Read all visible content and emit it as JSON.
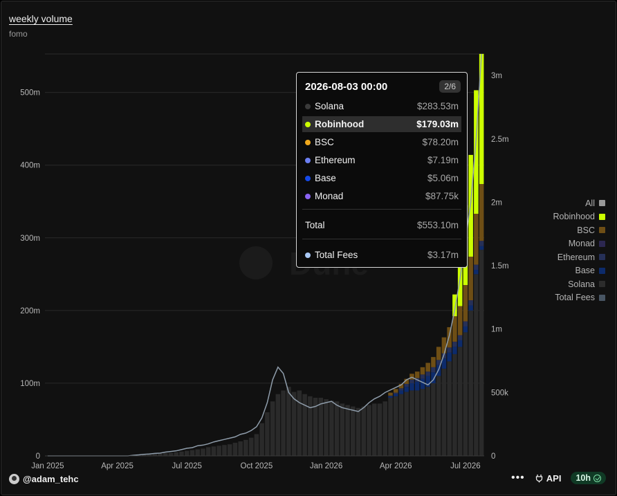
{
  "title": "weekly volume",
  "subtitle": "fomo",
  "footer": {
    "user": "@adam_tehc",
    "more": "•••",
    "api": "API",
    "refresh": "10h"
  },
  "tooltip": {
    "date": "2026-08-03 00:00",
    "page": "2/6",
    "rows": [
      {
        "name": "Solana",
        "value": "$283.53m",
        "color": "#3a3a3a"
      },
      {
        "name": "Robinhood",
        "value": "$179.03m",
        "color": "#ccff00",
        "highlight": true
      },
      {
        "name": "BSC",
        "value": "$78.20m",
        "color": "#f0a81c"
      },
      {
        "name": "Ethereum",
        "value": "$7.19m",
        "color": "#6c7ff2"
      },
      {
        "name": "Base",
        "value": "$5.06m",
        "color": "#1549e8"
      },
      {
        "name": "Monad",
        "value": "$87.75k",
        "color": "#8a63f2"
      }
    ],
    "total_label": "Total",
    "total_value": "$553.10m",
    "fees_label": "Total Fees",
    "fees_value": "$3.17m",
    "fees_color": "#a9c8f5"
  },
  "legend": [
    {
      "label": "All",
      "color": "#9a9a9a"
    },
    {
      "label": "Robinhood",
      "color": "#ccff00"
    },
    {
      "label": "BSC",
      "color": "#6e4e15"
    },
    {
      "label": "Monad",
      "color": "#2c2750"
    },
    {
      "label": "Ethereum",
      "color": "#263057"
    },
    {
      "label": "Base",
      "color": "#0d2b6b"
    },
    {
      "label": "Solana",
      "color": "#2c2c2c"
    },
    {
      "label": "Total Fees",
      "color": "#485563"
    }
  ],
  "chart_data": {
    "type": "bar",
    "stacked": true,
    "title": "weekly volume",
    "subtitle": "fomo",
    "x_ticks": [
      "Jan 2025",
      "Apr 2025",
      "Jul 2025",
      "Oct 2025",
      "Jan 2026",
      "Apr 2026",
      "Jul 2026"
    ],
    "y_ticks": [
      "0",
      "100m",
      "200m",
      "300m",
      "400m",
      "500m"
    ],
    "y2_ticks": [
      "0",
      "500k",
      "1m",
      "1.5m",
      "2m",
      "2.5m",
      "3m"
    ],
    "ylim": [
      0,
      553
    ],
    "y2lim": [
      0,
      3170000
    ],
    "grid": true,
    "legend_position": "right",
    "colors": {
      "Solana": "#2a2a2a",
      "Base": "#0d2b6b",
      "Ethereum": "#263057",
      "Monad": "#2c2750",
      "BSC": "#6e4e15",
      "Robinhood": "#ccff00",
      "Total Fees": "#8f9dab"
    },
    "weeks": 82,
    "series": [
      {
        "name": "Solana",
        "values": [
          0,
          0,
          0,
          0,
          0,
          0,
          0,
          0,
          0,
          0,
          0,
          0,
          0,
          0,
          0,
          0,
          0.5,
          1,
          1.5,
          2,
          3,
          3,
          4,
          4,
          5,
          6,
          7,
          8,
          9,
          10,
          12,
          13,
          14,
          15,
          16,
          18,
          20,
          22,
          25,
          30,
          45,
          60,
          75,
          85,
          90,
          95,
          88,
          90,
          85,
          82,
          80,
          80,
          78,
          76,
          75,
          72,
          70,
          68,
          66,
          68,
          70,
          72,
          72,
          75,
          80,
          82,
          85,
          88,
          90,
          90,
          92,
          95,
          100,
          110,
          120,
          130,
          140,
          150,
          170,
          200,
          250,
          283.53
        ]
      },
      {
        "name": "Base",
        "values": [
          0,
          0,
          0,
          0,
          0,
          0,
          0,
          0,
          0,
          0,
          0,
          0,
          0,
          0,
          0,
          0,
          0,
          0,
          0,
          0,
          0,
          0,
          0,
          0,
          0,
          0,
          0,
          0,
          0,
          0,
          0,
          0,
          0,
          0,
          0,
          0,
          0,
          0,
          0,
          0,
          0,
          0,
          0,
          0,
          0,
          0,
          0,
          0,
          0,
          0,
          0,
          0,
          0,
          0,
          0,
          0,
          0,
          0,
          0,
          0,
          0,
          0,
          0,
          0,
          2,
          3,
          5,
          7,
          10,
          12,
          14,
          15,
          15,
          15,
          14,
          12,
          10,
          9,
          8,
          7,
          6,
          5.06
        ]
      },
      {
        "name": "Ethereum",
        "values": [
          0,
          0,
          0,
          0,
          0,
          0,
          0,
          0,
          0,
          0,
          0,
          0,
          0,
          0,
          0,
          0,
          0,
          0,
          0,
          0,
          0,
          0,
          0,
          0,
          0,
          0,
          0,
          0,
          0,
          0,
          0,
          0,
          0,
          0,
          0,
          0,
          0,
          0,
          0,
          0,
          0,
          0,
          0,
          0,
          0,
          0,
          0,
          0,
          0,
          0,
          0,
          0,
          0,
          0,
          0,
          0,
          0,
          0,
          0,
          0,
          0,
          0,
          0,
          0,
          1,
          2,
          3,
          4,
          5,
          5,
          6,
          6,
          7,
          7,
          7,
          7,
          7,
          7,
          7,
          7,
          7,
          7.19
        ]
      },
      {
        "name": "Monad",
        "values": [
          0,
          0,
          0,
          0,
          0,
          0,
          0,
          0,
          0,
          0,
          0,
          0,
          0,
          0,
          0,
          0,
          0,
          0,
          0,
          0,
          0,
          0,
          0,
          0,
          0,
          0,
          0,
          0,
          0,
          0,
          0,
          0,
          0,
          0,
          0,
          0,
          0,
          0,
          0,
          0,
          0,
          0,
          0,
          0,
          0,
          0,
          0,
          0,
          0,
          0,
          0,
          0,
          0,
          0,
          0,
          0,
          0,
          0,
          0,
          0,
          0,
          0,
          0,
          0,
          0,
          0,
          0,
          0,
          0,
          0,
          0,
          0,
          0,
          0,
          0.1,
          0.1,
          0.1,
          0.1,
          0.1,
          0.1,
          0.1,
          0.088
        ]
      },
      {
        "name": "BSC",
        "values": [
          0,
          0,
          0,
          0,
          0,
          0,
          0,
          0,
          0,
          0,
          0,
          0,
          0,
          0,
          0,
          0,
          0,
          0,
          0,
          0,
          0,
          0,
          0,
          0,
          0,
          0,
          0,
          0,
          0,
          0,
          0,
          0,
          0,
          0,
          0,
          0,
          0,
          0,
          0,
          0,
          0,
          0,
          0,
          0,
          0,
          0,
          0,
          0,
          0,
          0,
          0,
          0,
          0,
          0,
          0,
          0,
          0,
          0,
          0,
          0,
          0,
          0,
          0,
          0,
          4,
          5,
          6,
          7,
          8,
          9,
          10,
          12,
          14,
          18,
          22,
          28,
          35,
          40,
          50,
          60,
          70,
          78.2
        ]
      },
      {
        "name": "Robinhood",
        "values": [
          0,
          0,
          0,
          0,
          0,
          0,
          0,
          0,
          0,
          0,
          0,
          0,
          0,
          0,
          0,
          0,
          0,
          0,
          0,
          0,
          0,
          0,
          0,
          0,
          0,
          0,
          0,
          0,
          0,
          0,
          0,
          0,
          0,
          0,
          0,
          0,
          0,
          0,
          0,
          0,
          0,
          0,
          0,
          0,
          0,
          0,
          0,
          0,
          0,
          0,
          0,
          0,
          0,
          0,
          0,
          0,
          0,
          0,
          0,
          0,
          0,
          0,
          0,
          0,
          0,
          0,
          0,
          0,
          0,
          0,
          0,
          0,
          0,
          0,
          0,
          0,
          30,
          80,
          110,
          140,
          170,
          179.03
        ]
      },
      {
        "name": "Total Fees",
        "axis": "right",
        "values": [
          0,
          0,
          0,
          0,
          0,
          0,
          0,
          0,
          0,
          0,
          0,
          0,
          0,
          0,
          0,
          0,
          5000,
          8000,
          12000,
          15000,
          20000,
          22000,
          30000,
          35000,
          40000,
          50000,
          60000,
          65000,
          80000,
          85000,
          95000,
          110000,
          120000,
          130000,
          140000,
          150000,
          170000,
          180000,
          200000,
          230000,
          300000,
          420000,
          600000,
          700000,
          650000,
          500000,
          450000,
          420000,
          400000,
          380000,
          390000,
          410000,
          420000,
          430000,
          400000,
          380000,
          370000,
          360000,
          350000,
          380000,
          420000,
          450000,
          470000,
          500000,
          520000,
          540000,
          560000,
          600000,
          620000,
          600000,
          580000,
          560000,
          600000,
          680000,
          800000,
          950000,
          1150000,
          1400000,
          1700000,
          2000000,
          2500000,
          3170000
        ]
      }
    ]
  }
}
